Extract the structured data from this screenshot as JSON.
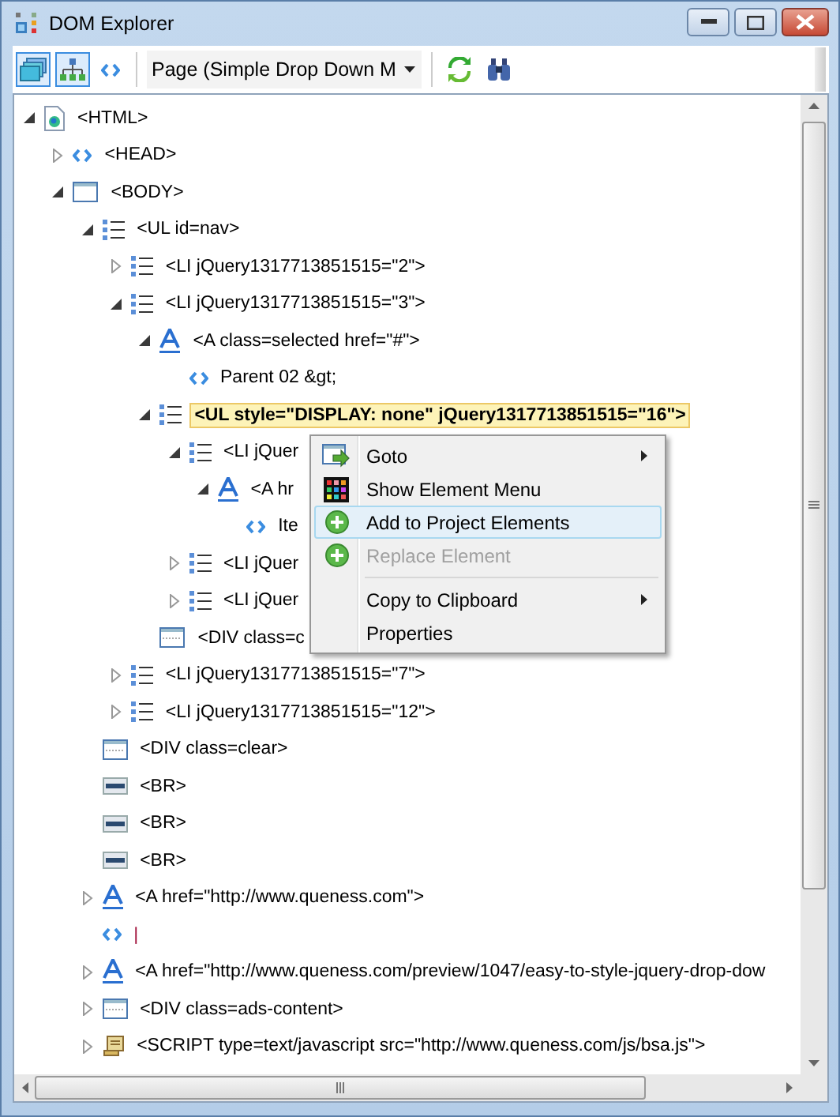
{
  "window": {
    "title": "DOM Explorer"
  },
  "toolbar": {
    "tool_buttons": [
      {
        "kind": "layers",
        "pressed": true
      },
      {
        "kind": "hierarchy",
        "pressed": true
      }
    ],
    "page_select": {
      "value": "Page (Simple Drop Down M"
    }
  },
  "tree": [
    {
      "text": "<HTML>",
      "kind": "document",
      "expanded": true,
      "selected": false,
      "children": [
        {
          "text": "<HEAD>",
          "kind": "code",
          "expanded": false,
          "selected": false
        },
        {
          "text": "<BODY>",
          "kind": "window",
          "expanded": true,
          "selected": false,
          "children": [
            {
              "text": "<UL id=nav>",
              "kind": "list",
              "expanded": true,
              "selected": false,
              "children": [
                {
                  "text": "<LI jQuery1317713851515=\"2\">",
                  "kind": "list",
                  "expanded": false,
                  "selected": false
                },
                {
                  "text": "<LI jQuery1317713851515=\"3\">",
                  "kind": "list",
                  "expanded": true,
                  "selected": false,
                  "children": [
                    {
                      "text": "<A class=selected href=\"#\">",
                      "kind": "anchor",
                      "expanded": true,
                      "selected": false,
                      "children": [
                        {
                          "text": "Parent 02 &gt;",
                          "kind": "code",
                          "selected": false
                        }
                      ]
                    },
                    {
                      "text": "<UL style=\"DISPLAY: none\" jQuery1317713851515=\"16\">",
                      "kind": "list",
                      "expanded": true,
                      "selected": true,
                      "children": [
                        {
                          "text": "<LI jQuer",
                          "kind": "list",
                          "expanded": true,
                          "selected": false,
                          "children": [
                            {
                              "text": "<A hr",
                              "kind": "anchor",
                              "expanded": true,
                              "selected": false,
                              "children": [
                                {
                                  "text": "Ite",
                                  "kind": "code",
                                  "selected": false
                                }
                              ]
                            }
                          ]
                        },
                        {
                          "text": "<LI jQuer",
                          "kind": "list",
                          "expanded": false,
                          "selected": false
                        },
                        {
                          "text": "<LI jQuer",
                          "kind": "list",
                          "expanded": false,
                          "selected": false
                        }
                      ]
                    },
                    {
                      "text": "<DIV class=c",
                      "kind": "div",
                      "selected": false
                    }
                  ]
                },
                {
                  "text": "<LI jQuery1317713851515=\"7\">",
                  "kind": "list",
                  "expanded": false,
                  "selected": false
                },
                {
                  "text": "<LI jQuery1317713851515=\"12\">",
                  "kind": "list",
                  "expanded": false,
                  "selected": false
                }
              ]
            },
            {
              "text": "<DIV class=clear>",
              "kind": "div",
              "selected": false
            },
            {
              "text": "<BR>",
              "kind": "br",
              "selected": false
            },
            {
              "text": "<BR>",
              "kind": "br",
              "selected": false
            },
            {
              "text": "<BR>",
              "kind": "br",
              "selected": false
            },
            {
              "text": "<A href=\"http://www.queness.com\">",
              "kind": "anchor",
              "expanded": false,
              "selected": false
            },
            {
              "text": "|",
              "kind": "text",
              "selected": false
            },
            {
              "text": "<A href=\"http://www.queness.com/preview/1047/easy-to-style-jquery-drop-dow",
              "kind": "anchor",
              "expanded": false,
              "selected": false
            },
            {
              "text": "<DIV class=ads-content>",
              "kind": "div",
              "expanded": false,
              "selected": false
            },
            {
              "text": "<SCRIPT type=text/javascript src=\"http://www.queness.com/js/bsa.js\">",
              "kind": "script",
              "expanded": false,
              "selected": false
            }
          ]
        }
      ]
    }
  ],
  "context_menu": [
    {
      "kind": "item",
      "label": "Goto",
      "submenu": true,
      "selected": false,
      "disabled": false
    },
    {
      "kind": "item",
      "label": "Show Element Menu",
      "submenu": false,
      "selected": false,
      "disabled": false
    },
    {
      "kind": "item",
      "label": "Add to Project Elements",
      "submenu": false,
      "selected": true,
      "disabled": false
    },
    {
      "kind": "item",
      "label": "Replace Element",
      "submenu": false,
      "selected": false,
      "disabled": true
    },
    {
      "kind": "separator"
    },
    {
      "kind": "item",
      "label": "Copy to Clipboard",
      "submenu": true,
      "selected": false,
      "disabled": false
    },
    {
      "kind": "item",
      "label": "Properties",
      "submenu": false,
      "selected": false,
      "disabled": false
    }
  ]
}
